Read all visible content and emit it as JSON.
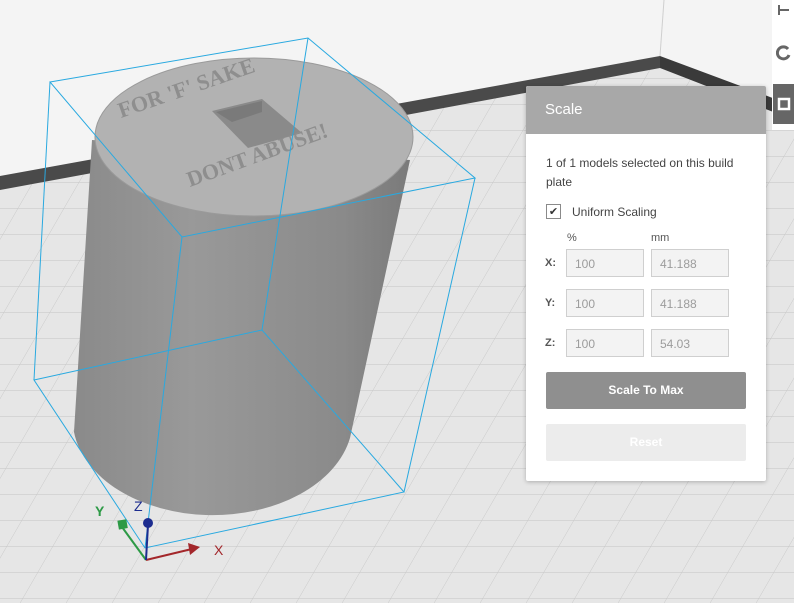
{
  "panel": {
    "title": "Scale",
    "selection_text": "1 of 1 models selected on this build plate",
    "uniform_scaling_label": "Uniform Scaling",
    "uniform_scaling_checked": true,
    "percent_header": "%",
    "mm_header": "mm",
    "rows": [
      {
        "axis": "X:",
        "percent": "100",
        "mm": "41.188"
      },
      {
        "axis": "Y:",
        "percent": "100",
        "mm": "41.188"
      },
      {
        "axis": "Z:",
        "percent": "100",
        "mm": "54.03"
      }
    ],
    "scale_to_max_label": "Scale To Max",
    "reset_label": "Reset"
  },
  "model": {
    "engraving_top": "FOR 'F' SAKE",
    "engraving_bottom": "DONT ABUSE!"
  },
  "gizmo": {
    "x_label": "X",
    "y_label": "Y",
    "z_label": "Z",
    "x_color": "#a3272b",
    "y_color": "#2d9a46",
    "z_color": "#1c2c8f"
  },
  "colors": {
    "accent_wire": "#29a9e0",
    "panel_header": "#a8a8a8"
  }
}
